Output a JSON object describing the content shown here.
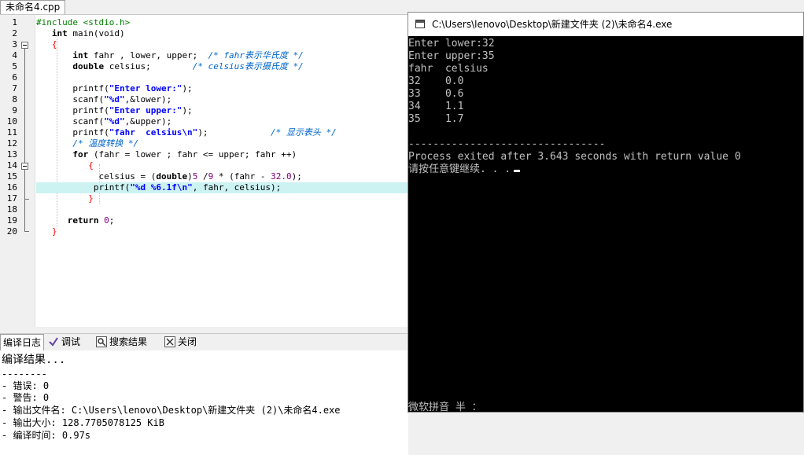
{
  "file_tab": "未命名4.cpp",
  "line_numbers": [
    "1",
    "2",
    "3",
    "4",
    "5",
    "6",
    "7",
    "8",
    "9",
    "10",
    "11",
    "12",
    "13",
    "14",
    "15",
    "16",
    "17",
    "18",
    "19",
    "20"
  ],
  "code": {
    "l1": "#include <stdio.h>",
    "l2_kw": "int",
    "l2_rest": " main(void)",
    "l3": "{",
    "l4_kw": "int",
    "l4_rest": " fahr , lower, upper;  ",
    "l4_cm": "/* fahr表示华氏度 */",
    "l5_kw": "double",
    "l5_rest": " celsius;        ",
    "l5_cm": "/* celsius表示摄氏度 */",
    "l7_a": "printf(",
    "l7_str": "\"Enter lower:\"",
    "l7_b": ");",
    "l8_a": "scanf(",
    "l8_str": "\"%d\"",
    "l8_b": ",&lower);",
    "l9_a": "printf(",
    "l9_str": "\"Enter upper:\"",
    "l9_b": ");",
    "l10_a": "scanf(",
    "l10_str": "\"%d\"",
    "l10_b": ",&upper);",
    "l11_a": "printf(",
    "l11_str": "\"fahr  celsius\\n\"",
    "l11_b": ");            ",
    "l11_cm": "/* 显示表头 */",
    "l12_cm": "/* 温度转换 */",
    "l13_kw": "for",
    "l13_rest": " (fahr = lower ; fahr <= upper; fahr ++)",
    "l14": "{",
    "l15_a": "celsius = (",
    "l15_kw": "double",
    "l15_b": ")",
    "l15_n1": "5",
    "l15_c": " /",
    "l15_n2": "9",
    "l15_d": " * (fahr - ",
    "l15_n3": "32.0",
    "l15_e": ");",
    "l16_a": "printf(",
    "l16_str": "\"%d %6.1f\\n\"",
    "l16_b": ", fahr, celsius);",
    "l17": "}",
    "l19_kw": "return",
    "l19_n": " 0",
    "l19_b": ";",
    "l20": "}"
  },
  "bottom_tabs": {
    "compile_log": "编译日志",
    "debug": "调试",
    "search_results": "搜索结果",
    "close": "关闭"
  },
  "compile_log": [
    "编译结果...",
    "--------",
    "- 错误: 0",
    "- 警告: 0",
    "- 输出文件名: C:\\Users\\lenovo\\Desktop\\新建文件夹 (2)\\未命名4.exe",
    "- 输出大小: 128.7705078125 KiB",
    "- 编译时间: 0.97s"
  ],
  "console": {
    "title": "C:\\Users\\lenovo\\Desktop\\新建文件夹 (2)\\未命名4.exe",
    "lines": [
      "Enter lower:32",
      "Enter upper:35",
      "fahr  celsius",
      "32    0.0",
      "33    0.6",
      "34    1.1",
      "35    1.7",
      "",
      "--------------------------------",
      "Process exited after 3.643 seconds with return value 0",
      "请按任意键继续. . ."
    ],
    "ime_status": "微软拼音 半 ："
  }
}
